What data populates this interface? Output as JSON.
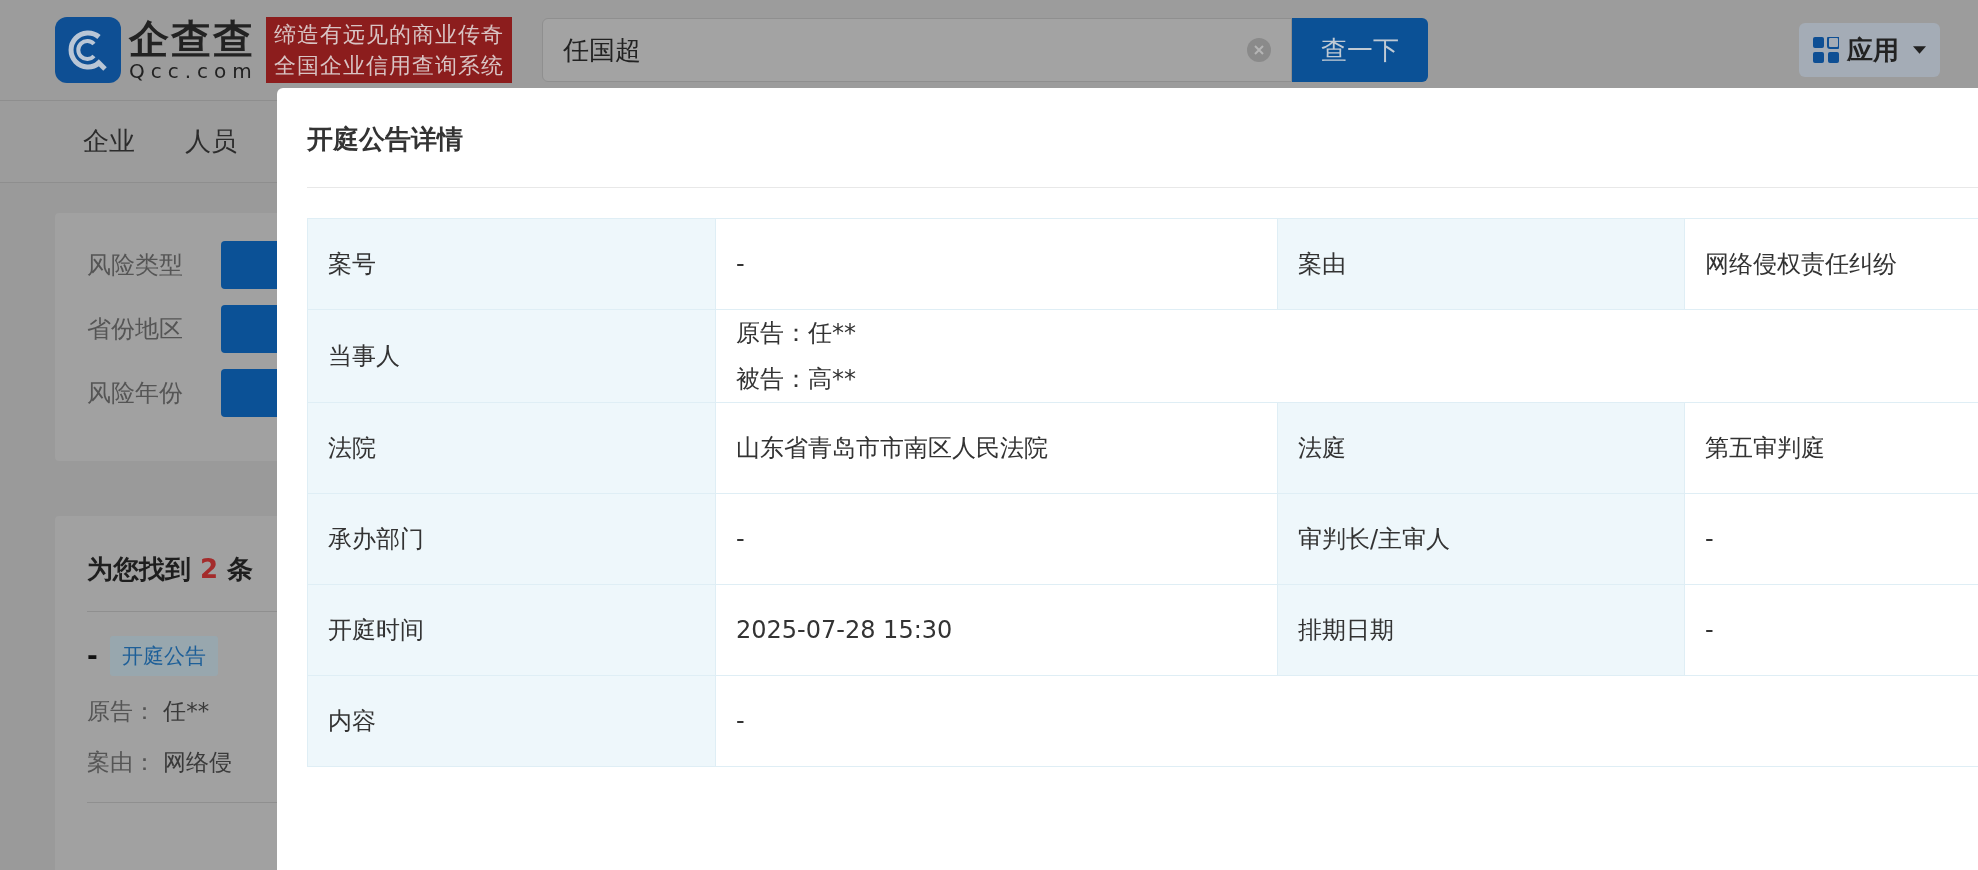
{
  "header": {
    "logo": {
      "brand": "企查查",
      "domain": "Qcc.com"
    },
    "slogan": [
      "缔造有远见的商业传奇",
      "全国企业信用查询系统"
    ],
    "search": {
      "value": "任国超",
      "button": "查一下"
    },
    "apps_menu": "应用"
  },
  "nav": [
    {
      "label": "企业"
    },
    {
      "label": "人员"
    }
  ],
  "filters": [
    {
      "label": "风险类型"
    },
    {
      "label": "省份地区"
    },
    {
      "label": "风险年份"
    }
  ],
  "results": {
    "prefix": "为您找到",
    "count": "2",
    "suffix": "条",
    "items": [
      {
        "title": "-",
        "tag": "开庭公告",
        "fields": [
          {
            "label": "原告：",
            "value": "任**"
          },
          {
            "label": "案由：",
            "value": "网络侵"
          }
        ]
      }
    ]
  },
  "modal": {
    "title": "开庭公告详情",
    "rows": [
      {
        "fields": [
          {
            "label": "案号",
            "lines": [
              "-"
            ]
          },
          {
            "label": "案由",
            "lines": [
              "网络侵权责任纠纷"
            ]
          }
        ]
      },
      {
        "fields": [
          {
            "label": "当事人",
            "lines": [
              "原告：任**",
              "被告：高**"
            ]
          }
        ]
      },
      {
        "fields": [
          {
            "label": "法院",
            "lines": [
              "山东省青岛市市南区人民法院"
            ]
          },
          {
            "label": "法庭",
            "lines": [
              "第五审判庭"
            ]
          }
        ]
      },
      {
        "fields": [
          {
            "label": "承办部门",
            "lines": [
              "-"
            ]
          },
          {
            "label": "审判长/主审人",
            "lines": [
              "-"
            ]
          }
        ]
      },
      {
        "fields": [
          {
            "label": "开庭时间",
            "lines": [
              "2025-07-28 15:30"
            ]
          },
          {
            "label": "排期日期",
            "lines": [
              "-"
            ]
          }
        ]
      },
      {
        "fields": [
          {
            "label": "内容",
            "lines": [
              "-"
            ]
          }
        ]
      }
    ]
  }
}
